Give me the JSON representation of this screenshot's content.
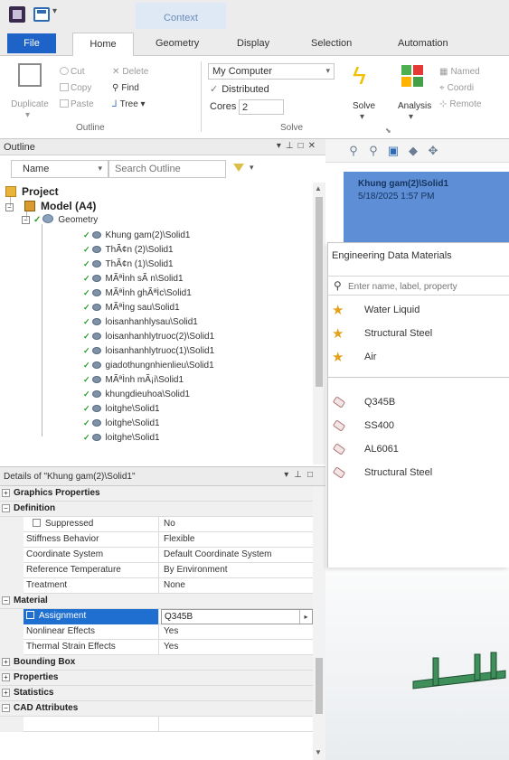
{
  "titlebar": {
    "context_tab": "Context"
  },
  "ribbon_tabs": [
    "File",
    "Home",
    "Geometry",
    "Display",
    "Selection",
    "Automation"
  ],
  "ribbon": {
    "duplicate": "Duplicate",
    "cut": "Cut",
    "copy": "Copy",
    "paste": "Paste",
    "delete": "Delete",
    "find": "Find",
    "tree": "Tree",
    "outline_group": "Outline",
    "computer": "My Computer",
    "distributed": "Distributed",
    "cores_label": "Cores",
    "cores_value": "2",
    "solve_group": "Solve",
    "solve": "Solve",
    "analysis": "Analysis",
    "named": "Named",
    "coordinate": "Coordi",
    "remote": "Remote"
  },
  "outline": {
    "title": "Outline",
    "column": "Name",
    "search_placeholder": "Search Outline",
    "project": "Project",
    "model": "Model (A4)",
    "geometry": "Geometry",
    "bodies": [
      "Khung gam(2)\\Solid1",
      "ThÃ¢n (2)\\Solid1",
      "ThÃ¢n (1)\\Solid1",
      "MÃªÌnh sÃ n\\Solid1",
      "MÃªÌnh ghÃªÌc\\Solid1",
      "MÃªÌng sau\\Solid1",
      "loisanhanhlysau\\Solid1",
      "loisanhanhlytruoc(2)\\Solid1",
      "loisanhanhlytruoc(1)\\Solid1",
      "giadothungnhienlieu\\Solid1",
      "MÃªÌnh mÃ¡i\\Solid1",
      "khungdieuhoa\\Solid1",
      "loitghe\\Solid1",
      "loitghe\\Solid1",
      "loitghe\\Solid1"
    ]
  },
  "details": {
    "title": "Details of \"Khung gam(2)\\Solid1\"",
    "categories": {
      "graphics": "Graphics Properties",
      "definition": "Definition",
      "material": "Material",
      "bounding_box": "Bounding Box",
      "properties": "Properties",
      "statistics": "Statistics",
      "cad_attributes": "CAD Attributes"
    },
    "rows": {
      "suppressed": {
        "key": "Suppressed",
        "value": "No"
      },
      "stiffness": {
        "key": "Stiffness Behavior",
        "value": "Flexible"
      },
      "coordinate": {
        "key": "Coordinate System",
        "value": "Default Coordinate System"
      },
      "reference_temp": {
        "key": "Reference Temperature",
        "value": "By Environment"
      },
      "treatment": {
        "key": "Treatment",
        "value": "None"
      },
      "assignment": {
        "key": "Assignment",
        "value": "Q345B"
      },
      "nonlinear": {
        "key": "Nonlinear Effects",
        "value": "Yes"
      },
      "thermal": {
        "key": "Thermal Strain Effects",
        "value": "Yes"
      }
    }
  },
  "graphics": {
    "label_title": "Khung gam(2)\\Solid1",
    "label_time": "5/18/2025 1:57 PM"
  },
  "engineering_data": {
    "title": "Engineering Data Materials",
    "search_placeholder": "Enter name, label, property",
    "favorites": [
      "Water Liquid",
      "Structural Steel",
      "Air"
    ],
    "materials": [
      "Q345B",
      "SS400",
      "AL6061",
      "Structural Steel"
    ]
  },
  "colors": {
    "file_tab": "#1e64c8",
    "selection": "#1f6fd0",
    "graphics_label": "#5d8ed6",
    "frame_green": "#3f8f5a"
  }
}
